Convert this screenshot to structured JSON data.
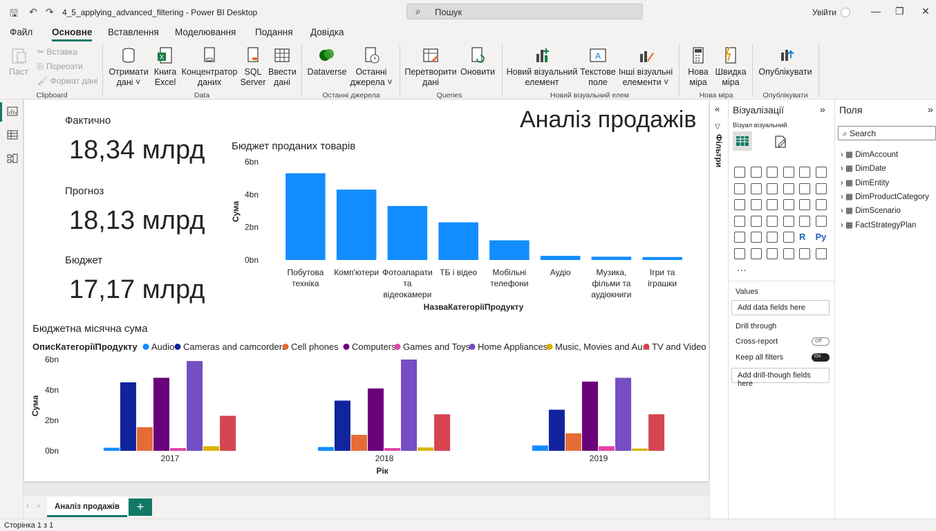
{
  "app": {
    "doc_title": "4_5_applying_advanced_filtering - Power BI Desktop",
    "search_placeholder": "Пошук",
    "sign_in": "Увійти"
  },
  "menu": [
    "Файл",
    "Основне",
    "Вставлення",
    "Моделювання",
    "Подання",
    "Довідка"
  ],
  "ribbon": {
    "clipboard": {
      "paste": "Паст",
      "insert": "Вставка",
      "cut": "Псреоэти",
      "format": "Формат дані",
      "group": "Clipboard"
    },
    "data": {
      "get_data": [
        "Отримати",
        "дані ˅"
      ],
      "excel": [
        "Книга",
        "Excel"
      ],
      "hub": [
        "Концентратор",
        "даних"
      ],
      "sql": [
        "SQL",
        "Server"
      ],
      "enter": [
        "Ввести",
        "дані"
      ],
      "group": "Data"
    },
    "recent": {
      "dataverse": "Dataverse",
      "recent": [
        "Останні",
        "джерела ˅"
      ],
      "group": "Останні джерела"
    },
    "queries": {
      "transform": [
        "Перетворити",
        "дані"
      ],
      "refresh": "Оновити",
      "group": "Queries"
    },
    "visual": {
      "new_visual": [
        "Новий візуальний",
        "елемент"
      ],
      "text_box": [
        "Текстове",
        "поле"
      ],
      "more": [
        "Інші візуальні",
        "елементи ˅"
      ],
      "group": "Новий візуальний елем"
    },
    "measure": {
      "new": [
        "Нова",
        "міра"
      ],
      "quick": [
        "Швидка",
        "міра"
      ],
      "group": "Нова міра"
    },
    "publish": {
      "label": "Опублікувати",
      "group": "Опублікувати"
    }
  },
  "report": {
    "title": "Аналіз продажів",
    "kpis": [
      {
        "label": "Фактично",
        "value": "18,34 млрд"
      },
      {
        "label": "Прогноз",
        "value": "18,13 млрд"
      },
      {
        "label": "Бюджет",
        "value": "17,17 млрд"
      }
    ]
  },
  "chart_data": [
    {
      "type": "bar",
      "title": "Бюджет проданих товарів",
      "xlabel": "НазваКатегоріїПродукту",
      "ylabel": "Сума",
      "yticks": [
        "0bn",
        "2bn",
        "4bn",
        "6bn"
      ],
      "ylim": [
        0,
        6
      ],
      "categories": [
        [
          "Побутова",
          "техніка"
        ],
        [
          "Комп'ютери"
        ],
        [
          "Фотоапарати",
          "та",
          "відеокамери"
        ],
        [
          "ТБ і відео"
        ],
        [
          "Мобільні",
          "телефони"
        ],
        [
          "Аудіо"
        ],
        [
          "Музика,",
          "фільми та",
          "аудіокниги"
        ],
        [
          "Ігри та",
          "іграшки"
        ]
      ],
      "values": [
        5.3,
        4.3,
        3.3,
        2.3,
        1.2,
        0.25,
        0.2,
        0.18
      ],
      "color": "#118dff"
    },
    {
      "type": "bar",
      "title": "Бюджетна місячна сума",
      "legend_title": "ОписКатегоріїПродукту",
      "xlabel": "Рік",
      "ylabel": "Сума",
      "yticks": [
        "0bn",
        "2bn",
        "4bn",
        "6bn"
      ],
      "ylim": [
        0,
        6
      ],
      "categories": [
        "2017",
        "2018",
        "2019"
      ],
      "series": [
        {
          "name": "Audio",
          "color": "#118dff",
          "values": [
            0.2,
            0.25,
            0.35
          ]
        },
        {
          "name": "Cameras and camcorders",
          "color": "#12239e",
          "values": [
            4.5,
            3.3,
            2.7
          ]
        },
        {
          "name": "Cell phones",
          "color": "#e66c37",
          "values": [
            1.55,
            1.05,
            1.15
          ]
        },
        {
          "name": "Computers",
          "color": "#6b007b",
          "values": [
            4.8,
            4.1,
            4.55
          ]
        },
        {
          "name": "Games and Toys",
          "color": "#e044a7",
          "values": [
            0.18,
            0.18,
            0.3
          ]
        },
        {
          "name": "Home Appliances",
          "color": "#744ec2",
          "values": [
            5.9,
            6.0,
            4.8
          ]
        },
        {
          "name": "Music, Movies and Au...",
          "color": "#d9b300",
          "values": [
            0.3,
            0.22,
            0.15
          ]
        },
        {
          "name": "TV and Video",
          "color": "#d64550",
          "values": [
            2.3,
            2.4,
            2.4
          ]
        }
      ]
    }
  ],
  "filters_label": "Фільтри",
  "viz_pane": {
    "title": "Візуалізації",
    "subtitle": "Візуал візуальний",
    "values_label": "Values",
    "values_well": "Add data fields here",
    "drill_label": "Drill through",
    "cross_report": "Cross-report",
    "cross_state": "Off",
    "keep_filters": "Keep all filters",
    "keep_state": "On",
    "drill_well": "Add drill-though fields here",
    "more": "···"
  },
  "fields_pane": {
    "title": "Поля",
    "search_placeholder": "Search",
    "tables": [
      "DimAccount",
      "DimDate",
      "DimEntity",
      "DimProductCategory",
      "DimScenario",
      "FactStrategyPlan"
    ]
  },
  "tabs": {
    "active": "Аналіз продажів",
    "add": "+"
  },
  "status": "Сторінка 1 з 1"
}
